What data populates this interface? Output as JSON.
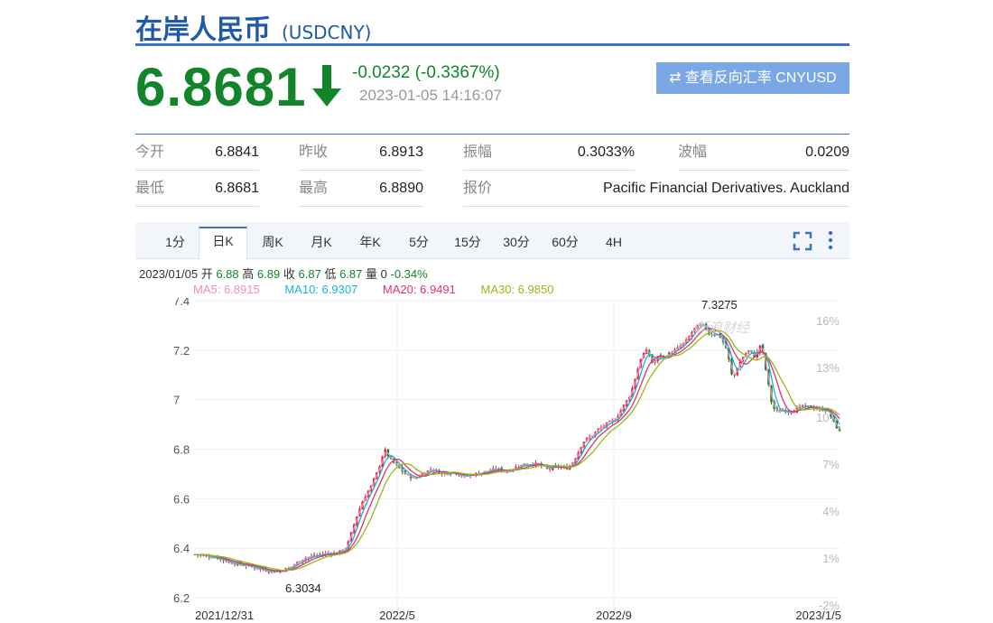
{
  "header": {
    "title": "在岸人民币",
    "code": "(USDCNY)"
  },
  "quote": {
    "price": "6.8681",
    "change": "-0.0232 (-0.3367%)",
    "time": "2023-01-05 14:16:07",
    "reverse_button": "查看反向汇率 CNYUSD"
  },
  "stats": [
    {
      "label": "今开",
      "value": "6.8841"
    },
    {
      "label": "昨收",
      "value": "6.8913"
    },
    {
      "label": "振幅",
      "value": "0.3033%"
    },
    {
      "label": "波幅",
      "value": "0.0209"
    },
    {
      "label": "最低",
      "value": "6.8681"
    },
    {
      "label": "最高",
      "value": "6.8890"
    },
    {
      "label": "报价",
      "value": "Pacific Financial Derivatives. Auckland"
    }
  ],
  "tabs": [
    "1分",
    "日K",
    "周K",
    "月K",
    "年K",
    "5分",
    "15分",
    "30分",
    "60分",
    "4H"
  ],
  "active_tab": "日K",
  "ohlc": {
    "date": "2023/01/05",
    "open_label": "开",
    "open": "6.88",
    "high_label": "高",
    "high": "6.89",
    "close_label": "收",
    "close": "6.87",
    "low_label": "低",
    "low": "6.87",
    "vol_label": "量",
    "vol": "0",
    "pct": "-0.34%"
  },
  "ma_legend": [
    {
      "label": "MA5: 6.8915",
      "color": "#f08fb3"
    },
    {
      "label": "MA10: 6.9307",
      "color": "#1ab3d8"
    },
    {
      "label": "MA20: 6.9491",
      "color": "#e8306a"
    },
    {
      "label": "MA30: 6.9850",
      "color": "#9ab817"
    }
  ],
  "colors": {
    "up": "#e0253a",
    "down": "#12852b",
    "accent": "#3b73c0"
  },
  "chart_data": {
    "type": "candlestick",
    "ylim": [
      6.2,
      7.4
    ],
    "y_ticks": [
      "7.4",
      "7.2",
      "7",
      "6.8",
      "6.6",
      "6.4",
      "6.2"
    ],
    "right_ticks": [
      {
        "label": "16%",
        "value": 7.32
      },
      {
        "label": "13%",
        "value": 7.13
      },
      {
        "label": "10%",
        "value": 6.93
      },
      {
        "label": "7%",
        "value": 6.74
      },
      {
        "label": "4%",
        "value": 6.55
      },
      {
        "label": "1%",
        "value": 6.36
      },
      {
        "label": "-2%",
        "value": 6.17
      }
    ],
    "x_labels": [
      "2021/12/31",
      "2022/5",
      "2022/9",
      "2023/1/5"
    ],
    "max_label": "7.3275",
    "min_label": "6.3034",
    "watermark": "新浪财经",
    "close_path": [
      [
        0,
        6.375
      ],
      [
        20,
        6.365
      ],
      [
        40,
        6.34
      ],
      [
        55,
        6.33
      ],
      [
        70,
        6.315
      ],
      [
        85,
        6.305
      ],
      [
        100,
        6.32
      ],
      [
        115,
        6.36
      ],
      [
        128,
        6.37
      ],
      [
        140,
        6.38
      ],
      [
        150,
        6.38
      ],
      [
        160,
        6.4
      ],
      [
        170,
        6.52
      ],
      [
        178,
        6.6
      ],
      [
        186,
        6.65
      ],
      [
        194,
        6.72
      ],
      [
        200,
        6.8
      ],
      [
        206,
        6.76
      ],
      [
        214,
        6.73
      ],
      [
        222,
        6.7
      ],
      [
        232,
        6.68
      ],
      [
        240,
        6.7
      ],
      [
        250,
        6.72
      ],
      [
        262,
        6.7
      ],
      [
        272,
        6.71
      ],
      [
        284,
        6.69
      ],
      [
        296,
        6.7
      ],
      [
        308,
        6.71
      ],
      [
        318,
        6.72
      ],
      [
        330,
        6.71
      ],
      [
        340,
        6.73
      ],
      [
        350,
        6.74
      ],
      [
        362,
        6.74
      ],
      [
        372,
        6.72
      ],
      [
        384,
        6.73
      ],
      [
        392,
        6.72
      ],
      [
        398,
        6.74
      ],
      [
        404,
        6.78
      ],
      [
        410,
        6.83
      ],
      [
        418,
        6.85
      ],
      [
        426,
        6.88
      ],
      [
        434,
        6.9
      ],
      [
        444,
        6.92
      ],
      [
        452,
        6.97
      ],
      [
        460,
        7.02
      ],
      [
        466,
        7.1
      ],
      [
        472,
        7.18
      ],
      [
        478,
        7.2
      ],
      [
        484,
        7.14
      ],
      [
        490,
        7.18
      ],
      [
        496,
        7.17
      ],
      [
        502,
        7.19
      ],
      [
        508,
        7.2
      ],
      [
        514,
        7.22
      ],
      [
        520,
        7.24
      ],
      [
        526,
        7.28
      ],
      [
        532,
        7.3
      ],
      [
        538,
        7.3
      ],
      [
        544,
        7.26
      ],
      [
        550,
        7.27
      ],
      [
        556,
        7.25
      ],
      [
        562,
        7.2
      ],
      [
        568,
        7.08
      ],
      [
        574,
        7.14
      ],
      [
        580,
        7.18
      ],
      [
        586,
        7.2
      ],
      [
        592,
        7.17
      ],
      [
        598,
        7.23
      ],
      [
        604,
        7.1
      ],
      [
        610,
        6.97
      ],
      [
        616,
        6.95
      ],
      [
        622,
        6.96
      ],
      [
        628,
        6.95
      ],
      [
        634,
        6.96
      ],
      [
        640,
        6.97
      ],
      [
        646,
        6.97
      ],
      [
        652,
        6.97
      ],
      [
        658,
        6.96
      ],
      [
        664,
        6.96
      ],
      [
        670,
        6.95
      ],
      [
        676,
        6.9
      ],
      [
        681,
        6.87
      ]
    ]
  }
}
